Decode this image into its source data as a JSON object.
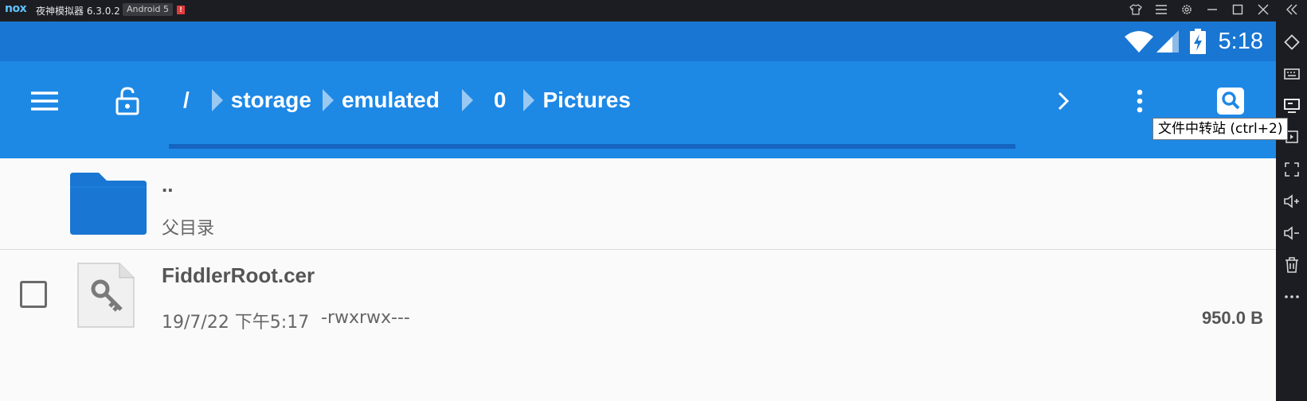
{
  "emulator": {
    "logo": "nox",
    "title": "夜神模拟器 6.3.0.2",
    "android_badge": "Android 5",
    "alert": "!",
    "controls": [
      "tshirt-icon",
      "menu-icon",
      "settings-icon",
      "minimize-icon",
      "maximize-icon",
      "close-icon",
      "collapse-icon"
    ],
    "sidebar_tools": [
      "rotate-icon",
      "keyboard-icon",
      "file-transfer-icon",
      "apk-install-icon",
      "fullscreen-icon",
      "volume-up-icon",
      "volume-down-icon",
      "trash-icon",
      "more-icon"
    ],
    "tooltip": "文件中转站 (ctrl+2)"
  },
  "status_bar": {
    "time": "5:18",
    "icons": [
      "wifi-icon",
      "signal-icon",
      "battery-charging-icon"
    ]
  },
  "app_bar": {
    "breadcrumbs": [
      "/",
      "storage",
      "emulated",
      "0",
      "Pictures"
    ],
    "icons": [
      "hamburger-icon",
      "unlock-icon",
      "chevron-right-icon",
      "overflow-icon",
      "search-icon"
    ]
  },
  "files": {
    "parent": {
      "name": "..",
      "subtitle": "父目录",
      "icon": "folder-icon"
    },
    "items": [
      {
        "name": "FiddlerRoot.cer",
        "date": "19/7/22 下午5:17",
        "permissions": "-rwxrwx---",
        "size": "950.0 B",
        "icon": "certificate-key-icon",
        "checked": false
      }
    ]
  },
  "colors": {
    "status_bar": "#1976d2",
    "app_bar": "#1e88e5",
    "folder": "#1976d2",
    "background": "#fafafa"
  }
}
